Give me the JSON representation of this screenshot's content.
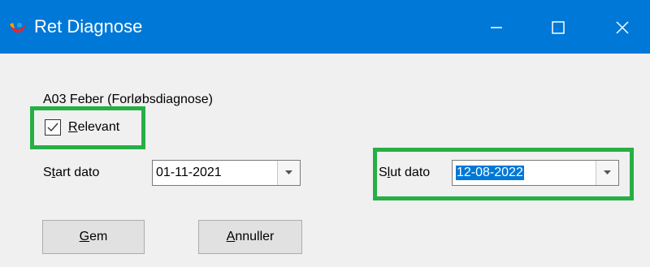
{
  "window": {
    "title": "Ret Diagnose"
  },
  "diagnosis": {
    "label": "A03 Feber (Forløbsdiagnose)"
  },
  "relevant": {
    "checked": true,
    "label_mnemonic": "R",
    "label_rest": "elevant"
  },
  "start_date": {
    "label_pre": "S",
    "label_mnemonic": "t",
    "label_rest": "art dato",
    "value": "01-11-2021"
  },
  "end_date": {
    "label_pre": "S",
    "label_mnemonic": "l",
    "label_rest": "ut dato",
    "value": "12-08-2022"
  },
  "buttons": {
    "save": {
      "mnemonic": "G",
      "rest": "em"
    },
    "cancel": {
      "mnemonic": "A",
      "rest": "nnuller"
    }
  },
  "colors": {
    "titlebar": "#0078d7",
    "highlight": "#26b044",
    "selection": "#0078d7"
  },
  "icons": {
    "app": "app-logo-icon",
    "minimize": "minimize-icon",
    "maximize": "maximize-icon",
    "close": "close-icon"
  }
}
